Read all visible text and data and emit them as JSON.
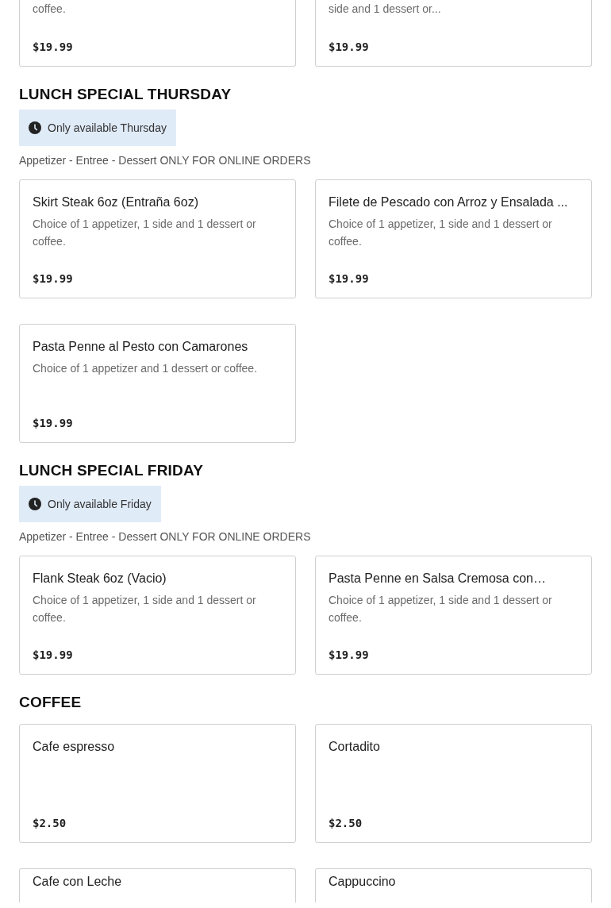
{
  "sections": [
    {
      "items": [
        {
          "description": "coffee.",
          "price": "$19.99"
        },
        {
          "description": "side and 1 dessert or...",
          "price": "$19.99"
        }
      ]
    },
    {
      "title": "LUNCH SPECIAL THURSDAY",
      "availability": "Only available Thursday",
      "note": "Appetizer - Entree - Dessert ONLY FOR ONLINE ORDERS",
      "items": [
        {
          "name": "Skirt Steak 6oz (Entraña 6oz)",
          "description": "Choice of 1 appetizer, 1 side and 1 dessert or coffee.",
          "price": "$19.99"
        },
        {
          "name": "Filete de Pescado con Arroz y Ensalada ...",
          "description": "Choice of 1 appetizer, 1 side and 1 dessert or coffee.",
          "price": "$19.99"
        },
        {
          "name": "Pasta Penne al Pesto con Camarones",
          "description": "Choice of 1 appetizer and 1 dessert or coffee.",
          "price": "$19.99"
        }
      ]
    },
    {
      "title": "LUNCH SPECIAL FRIDAY",
      "availability": "Only available Friday",
      "note": "Appetizer - Entree - Dessert ONLY FOR ONLINE ORDERS",
      "items": [
        {
          "name": "Flank Steak 6oz (Vacio)",
          "description": "Choice of 1 appetizer, 1 side and 1 dessert or coffee.",
          "price": "$19.99"
        },
        {
          "name": "Pasta Penne en Salsa Cremosa con…",
          "description": "Choice of 1 appetizer, 1 side and 1 dessert or coffee.",
          "price": "$19.99"
        }
      ]
    },
    {
      "title": "COFFEE",
      "items": [
        {
          "name": "Cafe espresso",
          "price": "$2.50"
        },
        {
          "name": "Cortadito",
          "price": "$2.50"
        },
        {
          "name": "Cafe con Leche"
        },
        {
          "name": "Cappuccino"
        }
      ]
    }
  ]
}
